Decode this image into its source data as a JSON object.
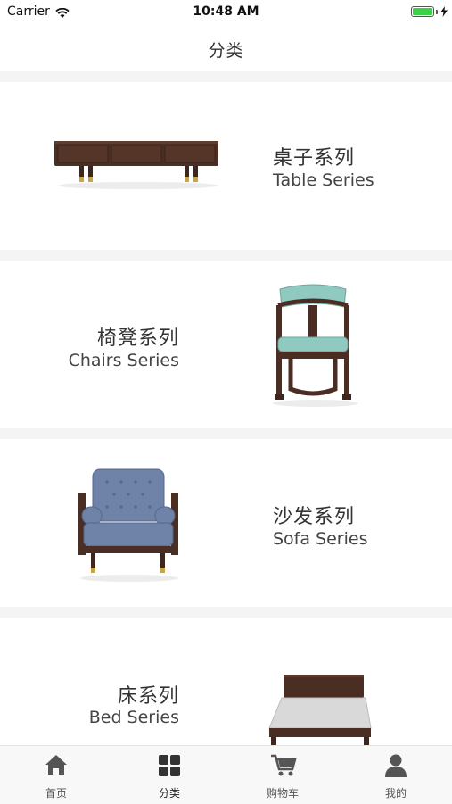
{
  "status_bar": {
    "carrier": "Carrier",
    "time": "10:48 AM"
  },
  "header": {
    "title": "分类"
  },
  "categories": [
    {
      "title_zh": "桌子系列",
      "title_en": "Table Series"
    },
    {
      "title_zh": "椅凳系列",
      "title_en": "Chairs Series"
    },
    {
      "title_zh": "沙发系列",
      "title_en": "Sofa Series"
    },
    {
      "title_zh": "床系列",
      "title_en": "Bed Series"
    }
  ],
  "tab_bar": {
    "items": [
      {
        "label": "首页",
        "icon": "home-icon"
      },
      {
        "label": "分类",
        "icon": "grid-icon"
      },
      {
        "label": "购物车",
        "icon": "cart-icon"
      },
      {
        "label": "我的",
        "icon": "user-icon"
      }
    ],
    "active": "分类"
  },
  "colors": {
    "walnut": "#4a2e24",
    "brass": "#c9a544",
    "chair_seat": "#8fc9c0",
    "sofa_fabric": "#6f82a8"
  }
}
